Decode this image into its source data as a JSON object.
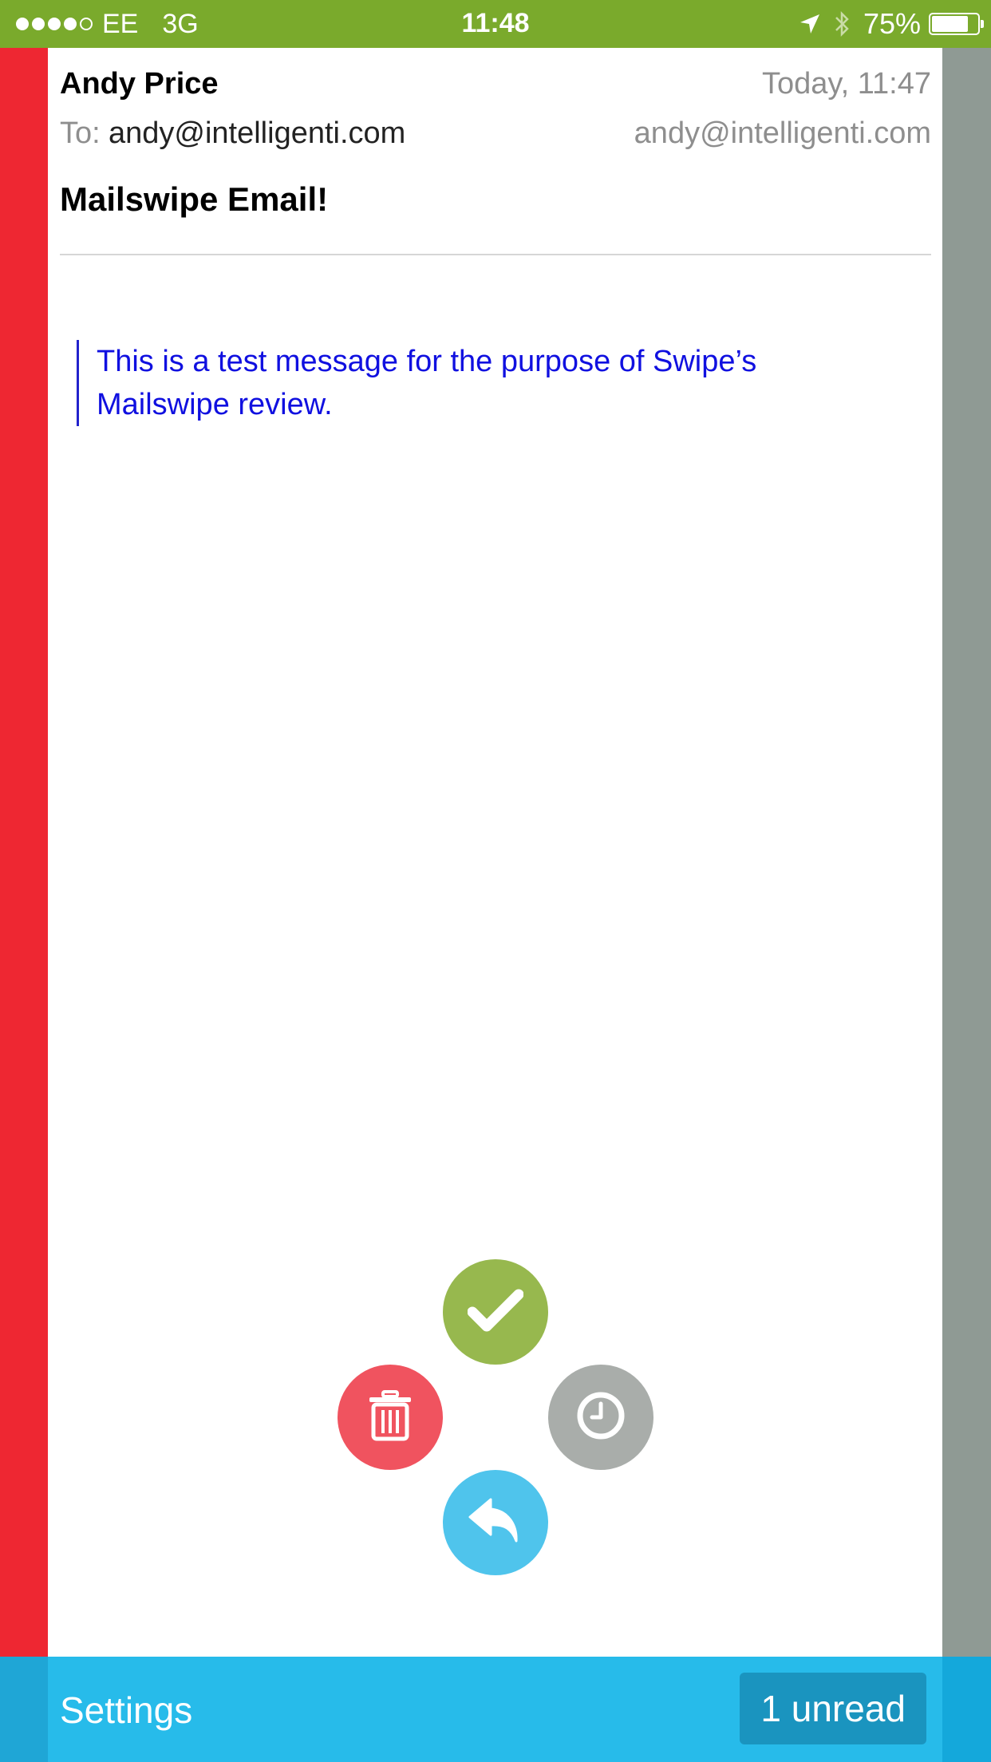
{
  "status_bar": {
    "carrier": "EE",
    "network": "3G",
    "time": "11:48",
    "battery_percent": "75%",
    "signal_bars_filled": 4,
    "signal_bars_total": 5
  },
  "email": {
    "sender": "Andy Price",
    "date": "Today, 11:47",
    "to_label": "To:",
    "to_address": "andy@intelligenti.com",
    "from_address": "andy@intelligenti.com",
    "subject": "Mailswipe Email!",
    "body_quote": "This is a test message for the purpose of Swipe’s Mailswipe review."
  },
  "actions": {
    "done_icon": "checkmark-icon",
    "delete_icon": "trash-icon",
    "later_icon": "clock-icon",
    "reply_icon": "reply-arrow-icon"
  },
  "bottom_bar": {
    "settings_label": "Settings",
    "unread_label": "1 unread"
  },
  "colors": {
    "status_bar": "#7aaa2c",
    "left_strip": "#ee2732",
    "right_strip": "#8f9a94",
    "done": "#97b84e",
    "delete": "#f0535f",
    "later": "#a9adaa",
    "reply": "#4fc4ec",
    "bottom_bar": "#27bbea",
    "quote_text": "#1010e0"
  }
}
